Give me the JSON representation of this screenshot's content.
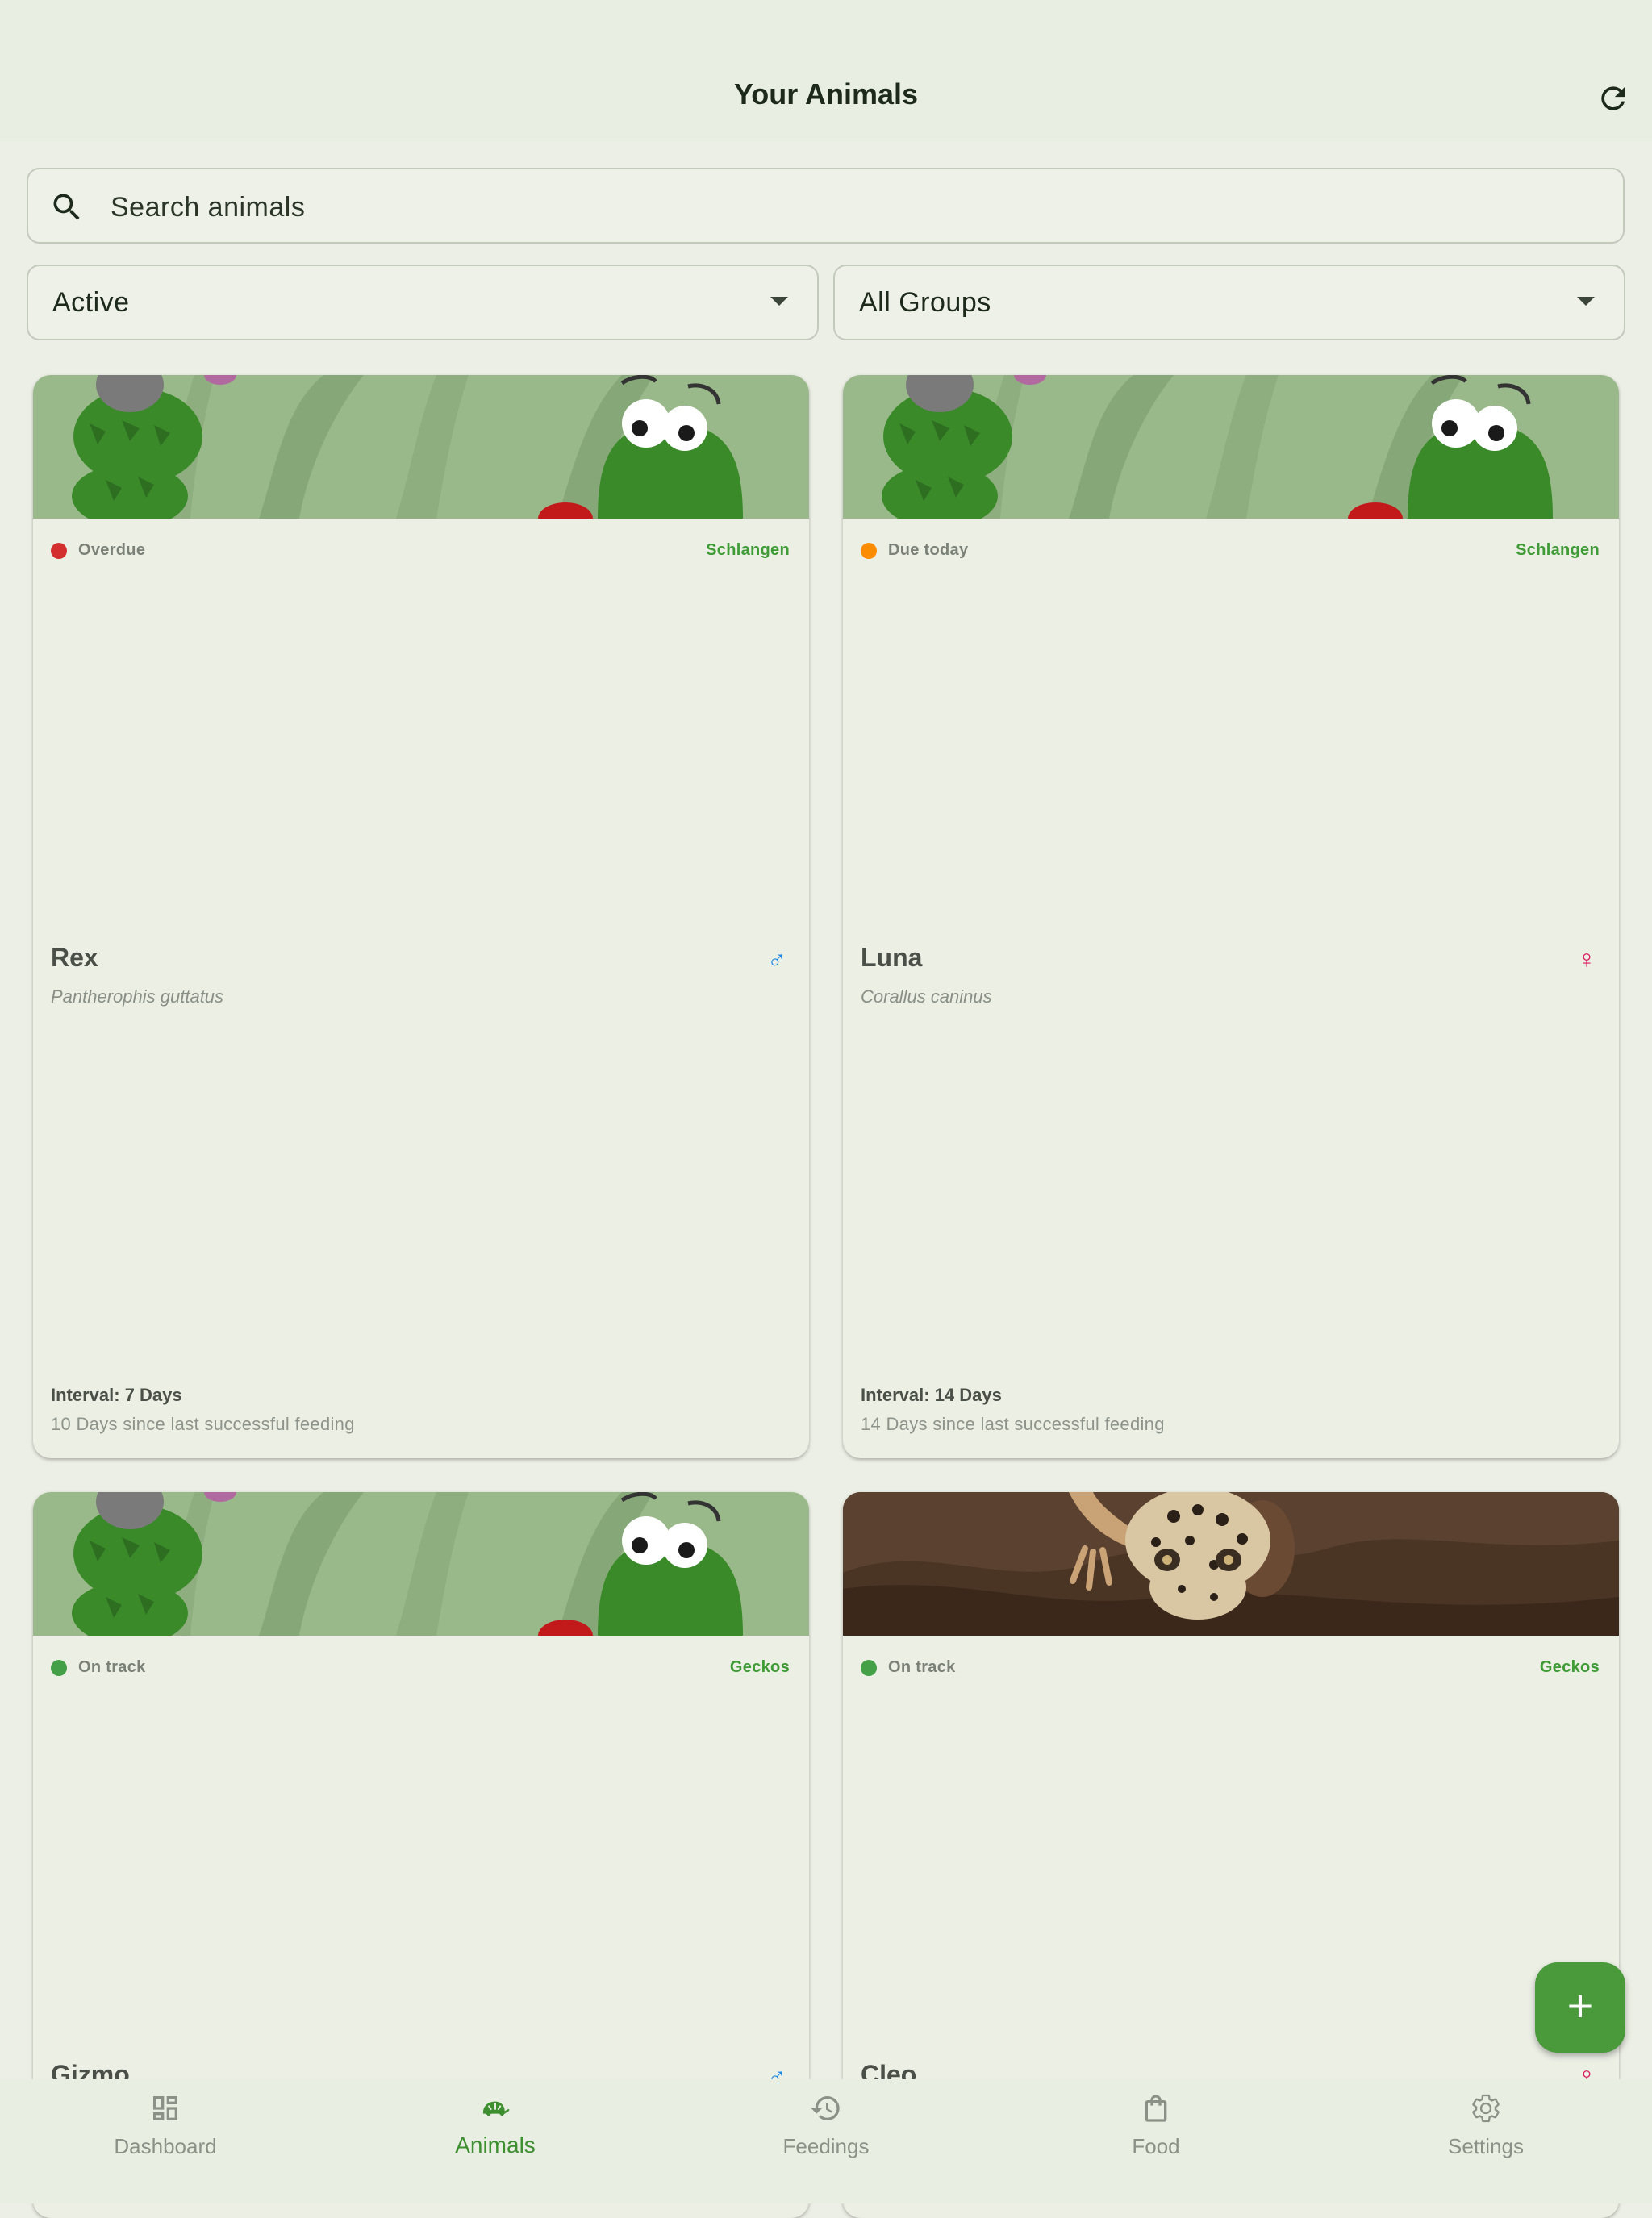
{
  "app_bar": {
    "title": "Your Animals"
  },
  "search": {
    "placeholder": "Search animals"
  },
  "filters": {
    "status": "Active",
    "group": "All Groups"
  },
  "animals": [
    {
      "status": "Overdue",
      "status_color": "#d32f2f",
      "group": "Schlangen",
      "name": "Rex",
      "gender": "♂",
      "gender_color": "#1e88e5",
      "species": "Pantherophis guttatus",
      "interval": "Interval: 7 Days",
      "since": "10 Days since last successful feeding",
      "image": "cartoon-snake"
    },
    {
      "status": "Due today",
      "status_color": "#fb8c00",
      "group": "Schlangen",
      "name": "Luna",
      "gender": "♀",
      "gender_color": "#d81b60",
      "species": "Corallus caninus",
      "interval": "Interval: 14 Days",
      "since": "14 Days since last successful feeding",
      "image": "cartoon-snake"
    },
    {
      "status": "On track",
      "status_color": "#43a047",
      "group": "Geckos",
      "name": "Gizmo",
      "gender": "♂",
      "gender_color": "#1e88e5",
      "image": "cartoon-snake"
    },
    {
      "status": "On track",
      "status_color": "#43a047",
      "group": "Geckos",
      "name": "Cleo",
      "gender": "♀",
      "gender_color": "#d81b60",
      "image": "leopard-gecko-photo"
    }
  ],
  "fab": {
    "icon": "plus-icon"
  },
  "nav": [
    {
      "label": "Dashboard",
      "icon": "dashboard-icon"
    },
    {
      "label": "Animals",
      "icon": "turtle-icon",
      "active": true
    },
    {
      "label": "Feedings",
      "icon": "history-icon"
    },
    {
      "label": "Food",
      "icon": "shopping-bag-icon"
    },
    {
      "label": "Settings",
      "icon": "gear-icon"
    }
  ],
  "colors": {
    "accent": "#4a9a3c",
    "background": "#ecefe5"
  }
}
